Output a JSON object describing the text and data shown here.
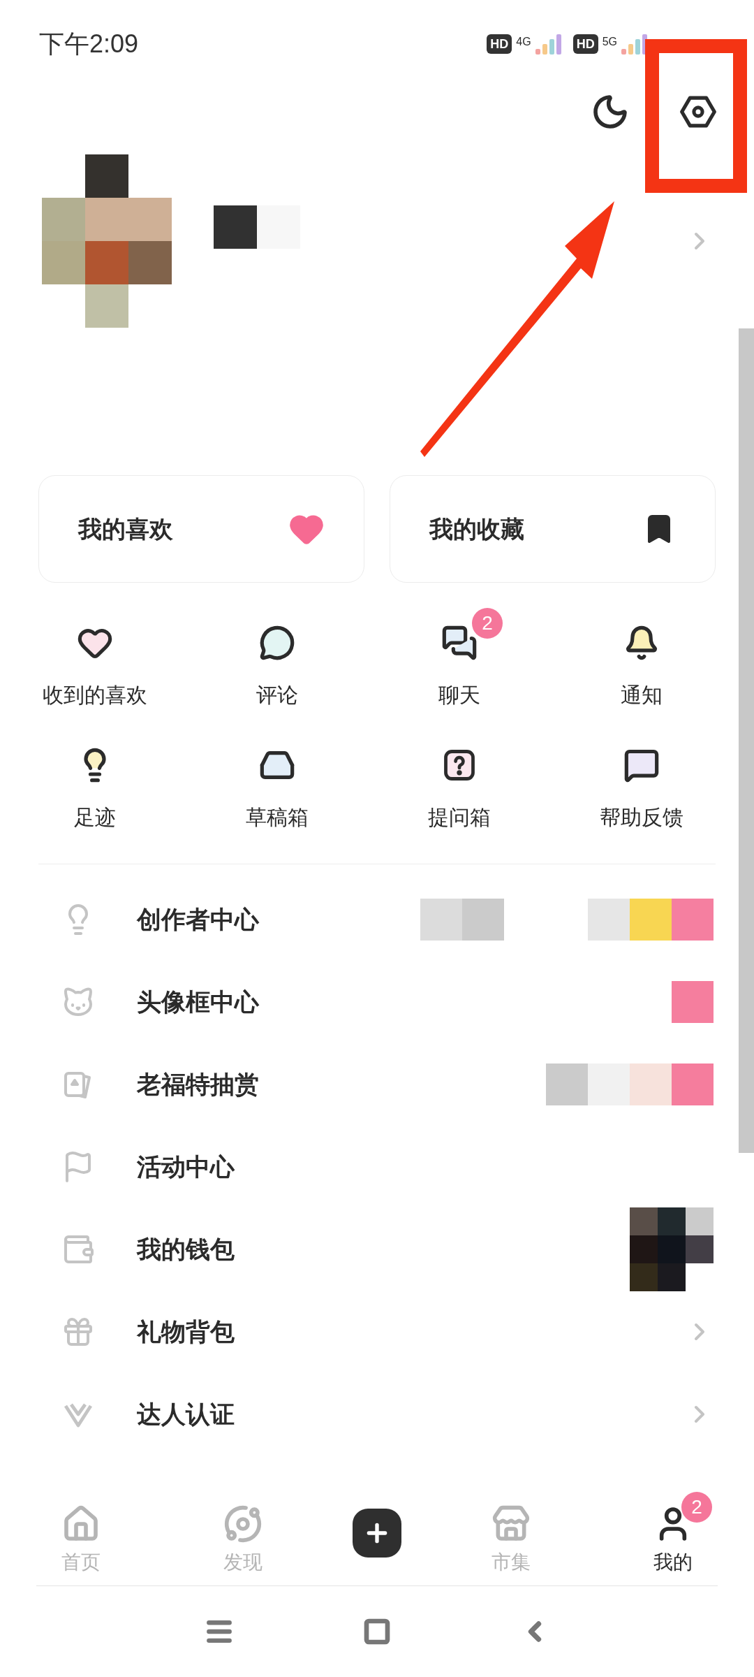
{
  "status_bar": {
    "time": "下午2:09",
    "sims": [
      {
        "badge": "HD",
        "network": "4G"
      },
      {
        "badge": "HD",
        "network": "5G"
      }
    ]
  },
  "cards": [
    {
      "label": "我的喜欢",
      "kind": "heart"
    },
    {
      "label": "我的收藏",
      "kind": "bookmark"
    }
  ],
  "shortcuts": [
    {
      "label": "收到的喜欢",
      "kind": "heart"
    },
    {
      "label": "评论",
      "kind": "comment"
    },
    {
      "label": "聊天",
      "kind": "chat",
      "badge": "2"
    },
    {
      "label": "通知",
      "kind": "bell"
    },
    {
      "label": "足迹",
      "kind": "bulb"
    },
    {
      "label": "草稿箱",
      "kind": "inbox"
    },
    {
      "label": "提问箱",
      "kind": "question"
    },
    {
      "label": "帮助反馈",
      "kind": "feedback"
    }
  ],
  "menu": [
    {
      "label": "创作者中心",
      "kind": "bulb",
      "chevron": false
    },
    {
      "label": "头像框中心",
      "kind": "cat",
      "chevron": false
    },
    {
      "label": "老福特抽赏",
      "kind": "cards",
      "chevron": false
    },
    {
      "label": "活动中心",
      "kind": "flag",
      "chevron": false
    },
    {
      "label": "我的钱包",
      "kind": "wallet",
      "chevron": false
    },
    {
      "label": "礼物背包",
      "kind": "gift",
      "chevron": true
    },
    {
      "label": "达人认证",
      "kind": "v",
      "chevron": true
    }
  ],
  "tab_bar": [
    {
      "label": "首页",
      "kind": "home",
      "selected": false
    },
    {
      "label": "发现",
      "kind": "planet",
      "selected": false
    },
    {
      "kind": "add",
      "selected": false
    },
    {
      "label": "市集",
      "kind": "store",
      "selected": false
    },
    {
      "label": "我的",
      "kind": "me",
      "selected": true,
      "badge": "2"
    }
  ]
}
